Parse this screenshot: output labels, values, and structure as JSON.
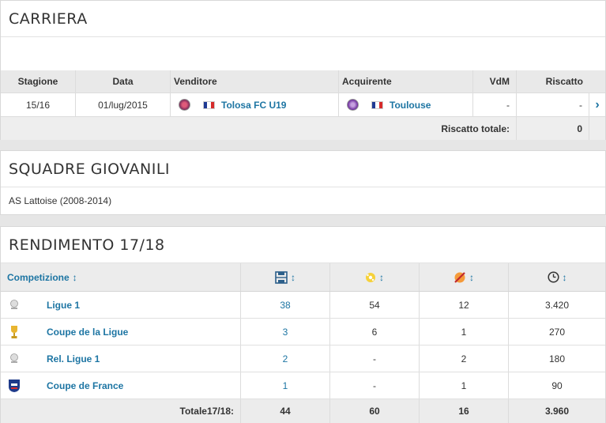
{
  "carriera": {
    "title": "CARRIERA",
    "headers": {
      "stagione": "Stagione",
      "data": "Data",
      "venditore": "Venditore",
      "acquirente": "Acquirente",
      "vdm": "VdM",
      "riscatto": "Riscatto"
    },
    "transfer": {
      "stagione": "15/16",
      "data": "01/lug/2015",
      "venditore": "Tolosa FC U19",
      "acquirente": "Toulouse",
      "vdm": "-",
      "riscatto": "-"
    },
    "total_label": "Riscatto totale:",
    "total_value": "0"
  },
  "giovanili": {
    "title": "SQUADRE GIOVANILI",
    "text": "AS Lattoise (2008-2014)"
  },
  "rendimento": {
    "title": "RENDIMENTO 17/18",
    "header_competizione": "Competizione",
    "header_icons": [
      "appearances-icon",
      "goals-icon",
      "substituted-icon",
      "clock-icon"
    ],
    "rows": [
      {
        "competizione": "Ligue 1",
        "icon": "ligue1-logo-icon",
        "presenze": "38",
        "gol": "54",
        "sost": "12",
        "minuti": "3.420"
      },
      {
        "competizione": "Coupe de la Ligue",
        "icon": "trophy-icon",
        "presenze": "3",
        "gol": "6",
        "sost": "1",
        "minuti": "270"
      },
      {
        "competizione": "Rel. Ligue 1",
        "icon": "ligue1-logo-icon",
        "presenze": "2",
        "gol": "-",
        "sost": "2",
        "minuti": "180"
      },
      {
        "competizione": "Coupe de France",
        "icon": "fff-logo-icon",
        "presenze": "1",
        "gol": "-",
        "sost": "1",
        "minuti": "90"
      }
    ],
    "total_label": "Totale17/18:",
    "total": {
      "presenze": "44",
      "gol": "60",
      "sost": "16",
      "minuti": "3.960"
    }
  },
  "colors": {
    "link": "#1d75a3",
    "header_bg": "#e9e9e9",
    "page_bg": "#e6e6e6"
  }
}
